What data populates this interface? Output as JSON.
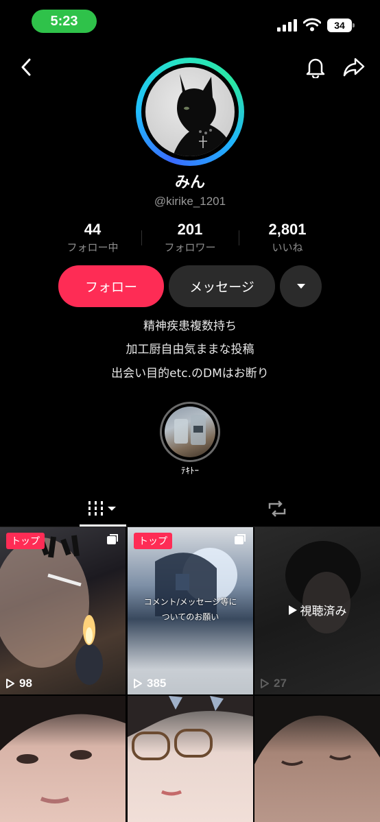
{
  "status_bar": {
    "time": "5:23",
    "battery": "34"
  },
  "profile": {
    "name": "みん",
    "handle": "@kirike_1201",
    "stats": [
      {
        "value": "44",
        "label": "フォロー中"
      },
      {
        "value": "201",
        "label": "フォロワー"
      },
      {
        "value": "2,801",
        "label": "いいね"
      }
    ],
    "bio": [
      "精神疾患複数持ち",
      "加工厨自由気ままな投稿",
      "出会い目的etc.のDMはお断り"
    ]
  },
  "actions": {
    "follow": "フォロー",
    "message": "メッセージ"
  },
  "highlight": {
    "label": "ﾃｷﾄｰ"
  },
  "videos": [
    {
      "badge": "トップ",
      "views": "98",
      "overlay": ""
    },
    {
      "badge": "トップ",
      "views": "385",
      "caption_line1": "コメント/メッセージ等に",
      "caption_line2": "ついてのお願い"
    },
    {
      "badge": "",
      "views": "27",
      "watched": "視聴済み"
    },
    {
      "badge": "",
      "views": ""
    },
    {
      "badge": "",
      "views": ""
    },
    {
      "badge": "",
      "views": ""
    }
  ],
  "colors": {
    "accent": "#fe2c55",
    "status_green": "#2fc24a",
    "button_dark": "#2b2b2b"
  }
}
